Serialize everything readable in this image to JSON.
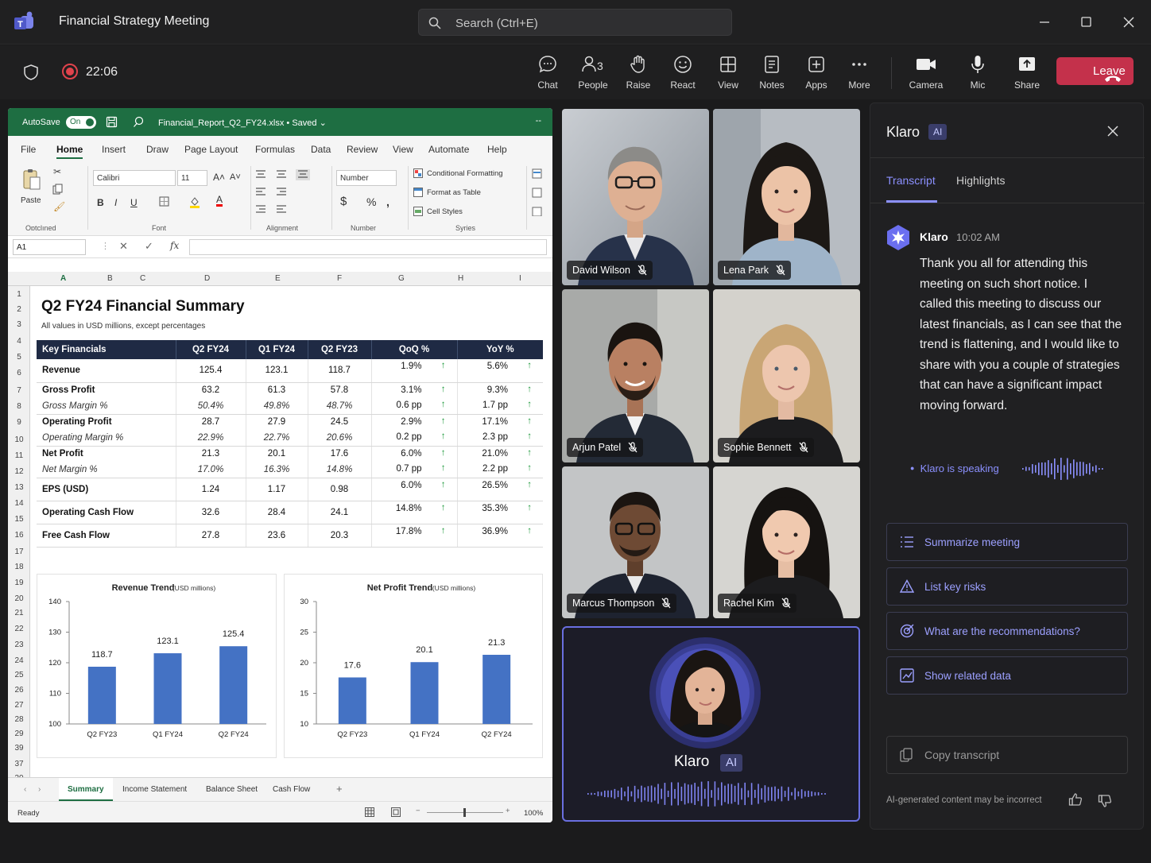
{
  "app": {
    "title": "Financial Strategy Meeting",
    "search_placeholder": "Search (Ctrl+E)"
  },
  "recording": {
    "time": "22:06"
  },
  "toolbar": [
    {
      "label": "Chat",
      "icon": "chat-icon"
    },
    {
      "label": "People",
      "icon": "people-icon"
    },
    {
      "label": "Raise",
      "icon": "raise-hand-icon"
    },
    {
      "label": "React",
      "icon": "react-icon"
    },
    {
      "label": "View",
      "icon": "view-icon"
    },
    {
      "label": "Notes",
      "icon": "notes-icon"
    },
    {
      "label": "Apps",
      "icon": "apps-icon"
    },
    {
      "label": "More",
      "icon": "more-icon"
    },
    {
      "label": "Camera",
      "icon": "camera-icon"
    },
    {
      "label": "Mic",
      "icon": "mic-icon"
    },
    {
      "label": "Share",
      "icon": "share-icon"
    }
  ],
  "leave_label": "Leave",
  "excel": {
    "autosave": "AutoSave",
    "autosave_state": "On",
    "filename": "Financial_Report_Q2_FY24.xlsx",
    "saved": "Saved",
    "menus": [
      "File",
      "Home",
      "Insert",
      "Draw",
      "Page Layout",
      "Formulas",
      "Data",
      "Review",
      "View",
      "Automate",
      "Help"
    ],
    "font_name": "Calibri",
    "font_size": "11",
    "number_format": "Number",
    "paste": "Paste",
    "clipboard_group": "Oɒtclıned",
    "font_group": "Font",
    "alignment_group": "Alignment",
    "number_group": "Number",
    "styles_group": "Syries",
    "cond_format": "Conditional Formatting",
    "format_table": "Format as Table",
    "cell_styles": "Cell Styles",
    "cell_ref": "A1",
    "columns": [
      "A",
      "B",
      "C",
      "D",
      "E",
      "F",
      "G",
      "H",
      "I"
    ],
    "rows": [
      "1",
      "2",
      "3",
      "4",
      "5",
      "6",
      "7",
      "8",
      "9",
      "10",
      "11",
      "12",
      "13",
      "14",
      "15",
      "16",
      "17",
      "18",
      "19",
      "20",
      "21",
      "22",
      "23",
      "24",
      "25",
      "26",
      "27",
      "28",
      "29",
      "39",
      "37",
      "30"
    ],
    "sheet_title": "Q2 FY24 Financial Summary",
    "sheet_subtitle": "All values in USD millions, except percentages",
    "table_headers": [
      "Key Financials",
      "Q2 FY24",
      "Q1 FY24",
      "Q2 FY23",
      "QoQ %",
      "YoY %"
    ],
    "table_rows": [
      {
        "label": "Revenue",
        "q2fy24": "125.4",
        "q1fy24": "123.1",
        "q2fy23": "118.7",
        "qoq": "1.9%",
        "yoy": "5.6%",
        "sub": null
      },
      {
        "label": "Gross Profit",
        "q2fy24": "63.2",
        "q1fy24": "61.3",
        "q2fy23": "57.8",
        "qoq": "3.1%",
        "yoy": "9.3%",
        "sub": {
          "label": "Gross Margin %",
          "q2fy24": "50.4%",
          "q1fy24": "49.8%",
          "q2fy23": "48.7%",
          "qoq": "0.6 pp",
          "yoy": "1.7 pp"
        }
      },
      {
        "label": "Operating Profit",
        "q2fy24": "28.7",
        "q1fy24": "27.9",
        "q2fy23": "24.5",
        "qoq": "2.9%",
        "yoy": "17.1%",
        "sub": {
          "label": "Operating Margin %",
          "q2fy24": "22.9%",
          "q1fy24": "22.7%",
          "q2fy23": "20.6%",
          "qoq": "0.2 pp",
          "yoy": "2.3 pp"
        }
      },
      {
        "label": "Net Profit",
        "q2fy24": "21.3",
        "q1fy24": "20.1",
        "q2fy23": "17.6",
        "qoq": "6.0%",
        "yoy": "21.0%",
        "sub": {
          "label": "Net Margin %",
          "q2fy24": "17.0%",
          "q1fy24": "16.3%",
          "q2fy23": "14.8%",
          "qoq": "0.7 pp",
          "yoy": "2.2 pp"
        }
      },
      {
        "label": "EPS (USD)",
        "q2fy24": "1.24",
        "q1fy24": "1.17",
        "q2fy23": "0.98",
        "qoq": "6.0%",
        "yoy": "26.5%",
        "sub": null
      },
      {
        "label": "Operating Cash Flow",
        "q2fy24": "32.6",
        "q1fy24": "28.4",
        "q2fy23": "24.1",
        "qoq": "14.8%",
        "yoy": "35.3%",
        "sub": null
      },
      {
        "label": "Free Cash Flow",
        "q2fy24": "27.8",
        "q1fy24": "23.6",
        "q2fy23": "20.3",
        "qoq": "17.8%",
        "yoy": "36.9%",
        "sub": null
      }
    ],
    "sheet_tabs": [
      "Summary",
      "Income Statement",
      "Balance Sheet",
      "Cash Flow"
    ],
    "status_ready": "Ready",
    "zoom": "100%"
  },
  "chart_data": [
    {
      "type": "bar",
      "title": "Revenue Trend",
      "subtitle": "(USD millions)",
      "categories": [
        "Q2 FY23",
        "Q1 FY24",
        "Q2 FY24"
      ],
      "values": [
        118.7,
        123.1,
        125.4
      ],
      "ylim": [
        100,
        140
      ],
      "yticks": [
        100,
        110,
        120,
        130,
        140
      ],
      "color": "#4472c4"
    },
    {
      "type": "bar",
      "title": "Net Profit Trend",
      "subtitle": "(USD millions)",
      "categories": [
        "Q2 FY23",
        "Q1 FY24",
        "Q2 FY24"
      ],
      "values": [
        17.6,
        20.1,
        21.3
      ],
      "ylim": [
        10,
        30
      ],
      "yticks": [
        10,
        15,
        20,
        25,
        30
      ],
      "color": "#4472c4"
    }
  ],
  "participants": [
    "David Wilson",
    "Lena Park",
    "Arjun Patel",
    "Sophie Bennett",
    "Marcus Thompson",
    "Rachel Kim"
  ],
  "klaro_tile": {
    "name": "Klaro",
    "badge": "AI"
  },
  "panel": {
    "title": "Klaro",
    "badge": "AI",
    "tab_transcript": "Transcript",
    "tab_highlights": "Highlights",
    "speaker": "Klaro",
    "time": "10:02 AM",
    "transcript": "Thank you all for attending this meeting on such short notice. I called this meeting to discuss our latest financials, as I can see that the trend is flattening, and I would like to share with you a couple of strategies that can have a significant impact moving forward.",
    "speaking": "Klaro is speaking",
    "actions": [
      "Summarize meeting",
      "List key risks",
      "What are the recommendations?",
      "Show related data"
    ],
    "copy": "Copy transcript",
    "disclaimer": "AI-generated content may be incorrect"
  },
  "colors": {
    "accent": "#8b90ff",
    "leave": "#c4314b",
    "excel_green": "#1e6e42",
    "bar": "#4472c4",
    "header_navy": "#1f2a44"
  }
}
